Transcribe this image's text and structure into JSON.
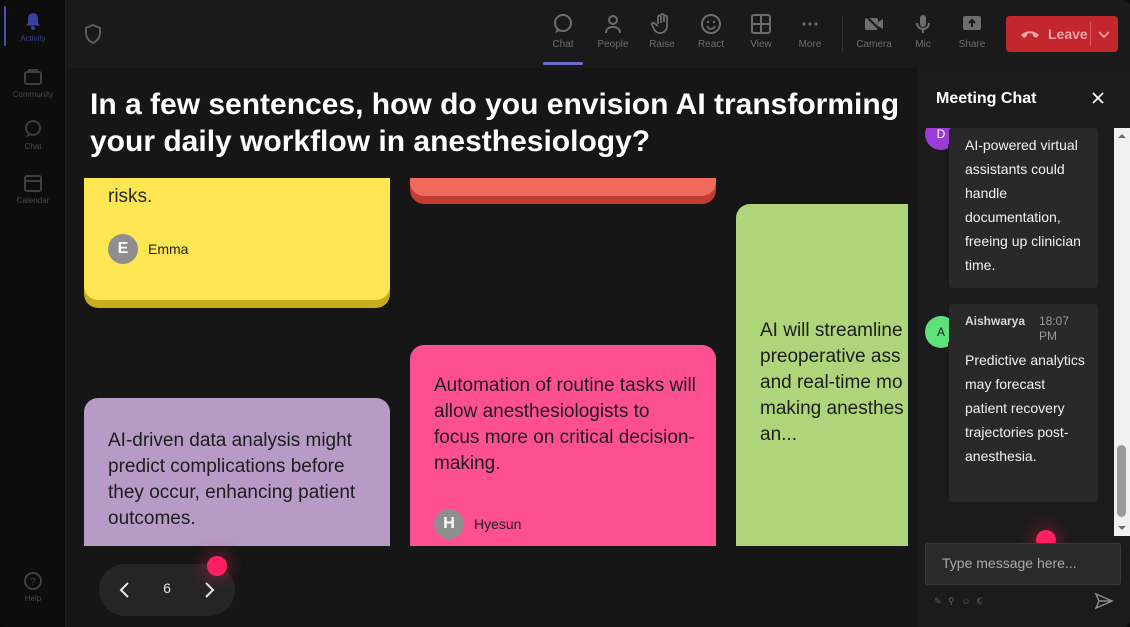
{
  "rail": {
    "items": [
      {
        "label": "Activity",
        "icon": "bell-icon"
      },
      {
        "label": "Community",
        "icon": "community-icon"
      },
      {
        "label": "Chat",
        "icon": "chat-icon"
      },
      {
        "label": "Calendar",
        "icon": "calendar-icon"
      },
      {
        "label": "Help",
        "icon": "help-icon"
      }
    ]
  },
  "toolbar": {
    "chat": "Chat",
    "people": "People",
    "raise": "Raise",
    "react": "React",
    "view": "View",
    "more": "More",
    "camera": "Camera",
    "mic": "Mic",
    "share": "Share",
    "leave": "Leave"
  },
  "main": {
    "question": "In a few sentences, how do you envision AI transforming your daily workflow in anesthesiology?",
    "cards": [
      {
        "text": "risks.",
        "author": "Emma",
        "initial": "E",
        "color": "#fde652"
      },
      {
        "text": "AI-driven data analysis might predict complications before they occur, enhancing patient outcomes.",
        "color": "#b79ac6"
      },
      {
        "text": "",
        "color": "#f06a5e"
      },
      {
        "text": "Automation of routine tasks will allow anesthesiologists to focus more on critical decision-making.",
        "author": "Hyesun",
        "initial": "H",
        "color": "#fe4f93"
      },
      {
        "text": "AI will streamline preoperative ass and real-time mo making anesthes an...",
        "color": "#aed57a"
      }
    ],
    "page": "6"
  },
  "chat": {
    "title": "Meeting Chat",
    "messages": [
      {
        "initial": "D",
        "body": "AI-powered virtual assistants could handle documentation, freeing up clinician time.",
        "color": "#9b3cd6"
      },
      {
        "initial": "A",
        "sender": "Aishwarya",
        "time": "18:07 PM",
        "body": "Predictive analytics may forecast patient recovery trajectories post-anesthesia.",
        "color": "#5ee07a"
      }
    ],
    "composer_placeholder": "Type message here..."
  }
}
